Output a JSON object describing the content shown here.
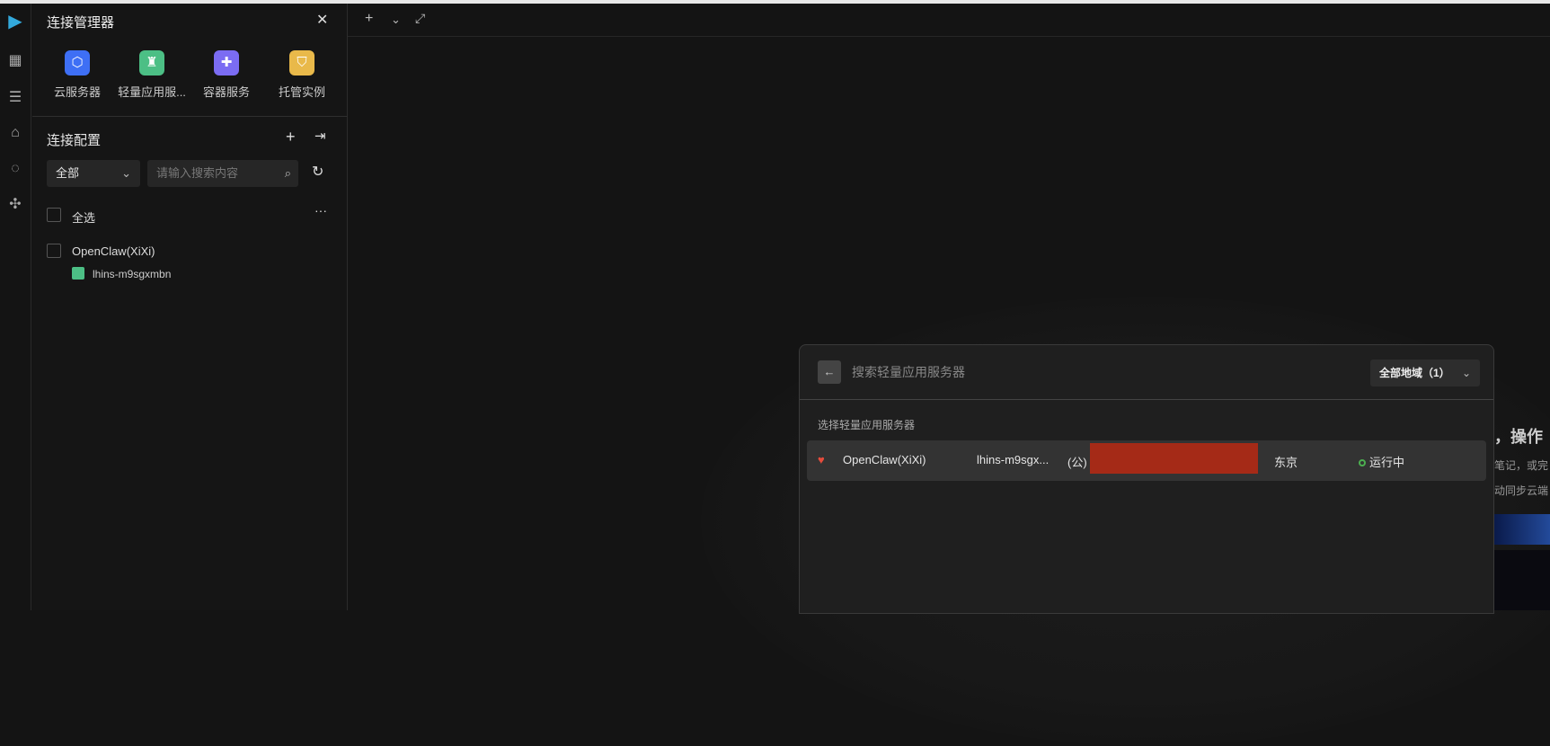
{
  "panel": {
    "title": "连接管理器",
    "services": [
      {
        "label": "云服务器",
        "icon": "cloud-server-icon",
        "color": "#3e6ff5"
      },
      {
        "label": "轻量应用服...",
        "icon": "lighthouse-icon",
        "color": "#4cbf85"
      },
      {
        "label": "容器服务",
        "icon": "container-icon",
        "color": "#7b6cf3"
      },
      {
        "label": "托管实例",
        "icon": "managed-instance-icon",
        "color": "#e9b94a"
      }
    ],
    "section_title": "连接配置",
    "filter": {
      "selected": "全部",
      "search_placeholder": "请输入搜索内容"
    },
    "select_all": "全选",
    "groups": [
      {
        "name": "OpenClaw(XiXi)",
        "children": [
          "lhins-m9sgxmbn"
        ]
      }
    ]
  },
  "modal": {
    "search_placeholder": "搜索轻量应用服务器",
    "region": "全部地域（1）",
    "section_label": "选择轻量应用服务器",
    "rows": [
      {
        "name": "OpenClaw(XiXi)",
        "id": "lhins-m9sgx...",
        "ip_prefix": "(公) 4",
        "region": "东京",
        "status": "运行中"
      }
    ]
  },
  "background": {
    "lines": [
      "，操作",
      "笔记，或完",
      "动同步云端"
    ]
  }
}
